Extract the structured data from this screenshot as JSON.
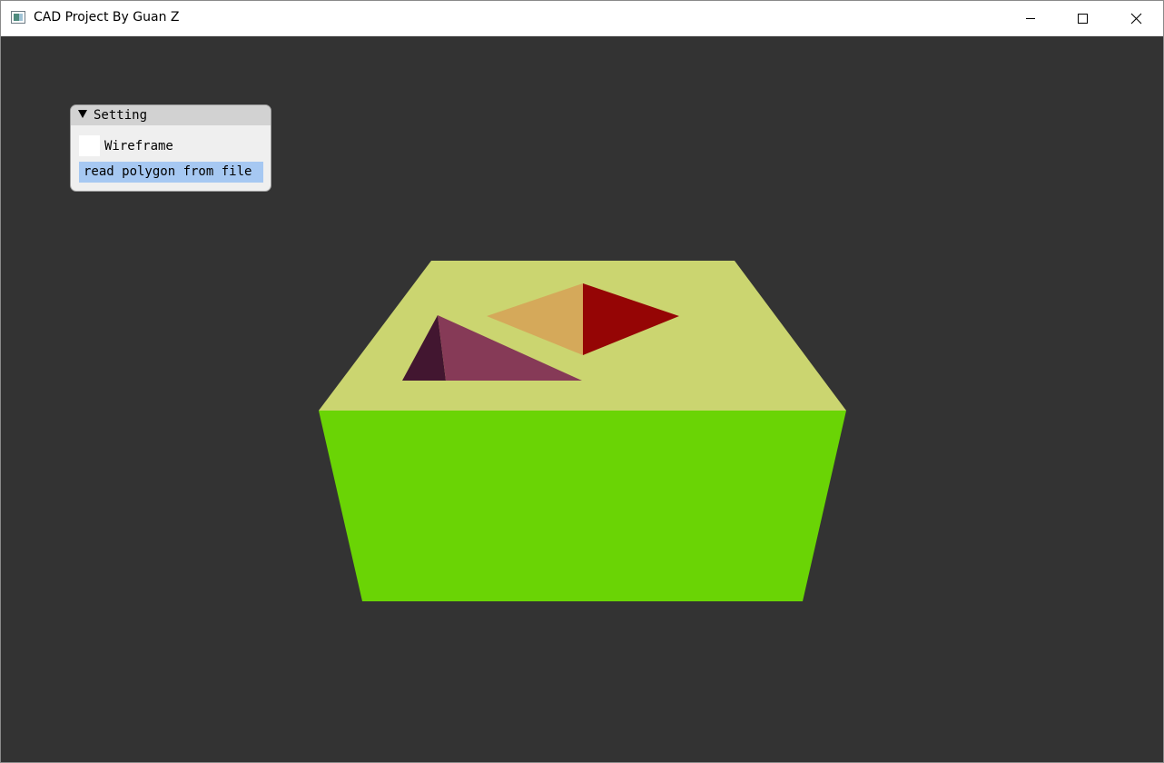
{
  "window": {
    "title": "CAD Project By Guan Z",
    "icon": "app-window-icon",
    "controls": {
      "minimize_icon": "minimize-icon",
      "maximize_icon": "maximize-icon",
      "close_icon": "close-icon"
    }
  },
  "settings_panel": {
    "title": "Setting",
    "collapse_icon": "triangle-down-icon",
    "wireframe": {
      "label": "Wireframe",
      "checked": false
    },
    "read_button_label": "read polygon from file"
  },
  "scene": {
    "background_color": "#333333",
    "faces": [
      {
        "name": "top-face",
        "color": "#cbd570"
      },
      {
        "name": "front-face",
        "color": "#6ad405"
      },
      {
        "name": "left-hole-dark-wall",
        "color": "#421630"
      },
      {
        "name": "left-hole-wall",
        "color": "#863a57"
      },
      {
        "name": "right-hole-orange-wall",
        "color": "#d5a95a"
      },
      {
        "name": "right-hole-red-wall",
        "color": "#950505"
      }
    ]
  }
}
